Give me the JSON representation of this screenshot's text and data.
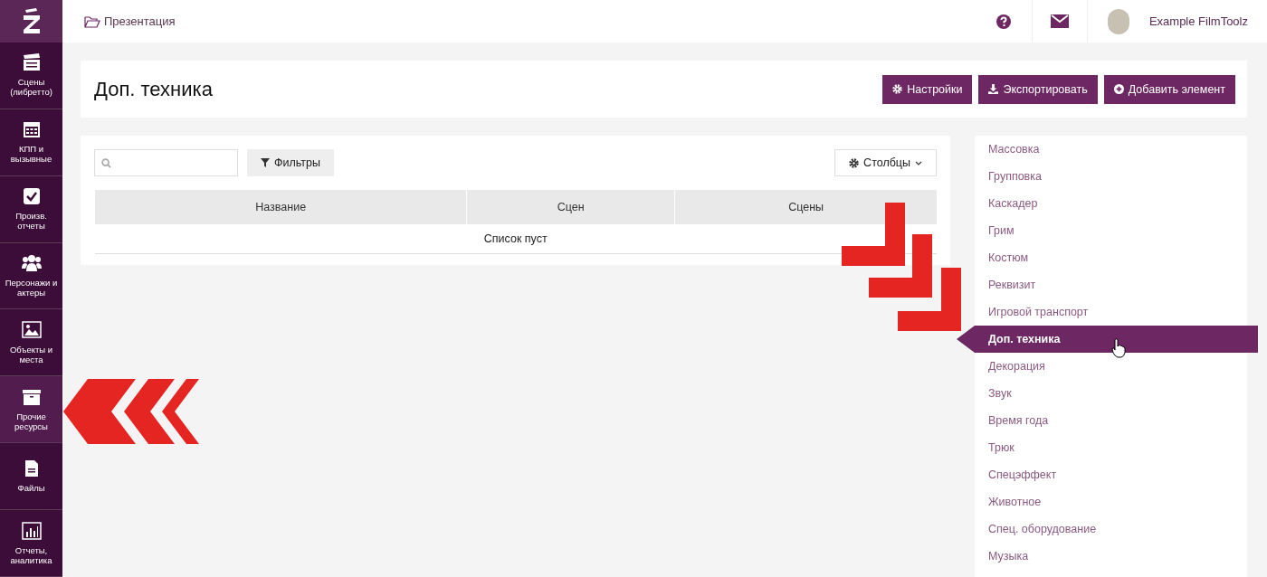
{
  "sidebar": {
    "items": [
      {
        "label": "Сцены (либретто)",
        "selected": false
      },
      {
        "label": "КПП и вызывные",
        "selected": false
      },
      {
        "label": "Произв. отчеты",
        "selected": false
      },
      {
        "label": "Персонажи и актеры",
        "selected": false
      },
      {
        "label": "Объекты и места",
        "selected": false
      },
      {
        "label": "Прочие ресурсы",
        "selected": true
      },
      {
        "label": "Файлы",
        "selected": false
      },
      {
        "label": "Отчеты, аналитика",
        "selected": false
      }
    ]
  },
  "breadcrumb": "Презентация",
  "user": {
    "name": "Example FilmToolz"
  },
  "page_title": "Доп. техника",
  "actions": [
    {
      "label": "Настройки"
    },
    {
      "label": "Экспортировать"
    },
    {
      "label": "Добавить элемент"
    }
  ],
  "toolbar": {
    "filter": "Фильтры",
    "columns": "Столбцы"
  },
  "table": {
    "columns": [
      "Название",
      "Сцен",
      "Сцены"
    ],
    "empty": "Список пуст"
  },
  "categories": [
    {
      "label": "Массовка",
      "selected": false
    },
    {
      "label": "Групповка",
      "selected": false
    },
    {
      "label": "Каскадер",
      "selected": false
    },
    {
      "label": "Грим",
      "selected": false
    },
    {
      "label": "Костюм",
      "selected": false
    },
    {
      "label": "Реквизит",
      "selected": false
    },
    {
      "label": "Игровой транспорт",
      "selected": false
    },
    {
      "label": "Доп. техника",
      "selected": true
    },
    {
      "label": "Декорация",
      "selected": false
    },
    {
      "label": "Звук",
      "selected": false
    },
    {
      "label": "Время года",
      "selected": false
    },
    {
      "label": "Трюк",
      "selected": false
    },
    {
      "label": "Спецэффект",
      "selected": false
    },
    {
      "label": "Животное",
      "selected": false
    },
    {
      "label": "Спец. оборудование",
      "selected": false
    },
    {
      "label": "Музыка",
      "selected": false
    }
  ]
}
